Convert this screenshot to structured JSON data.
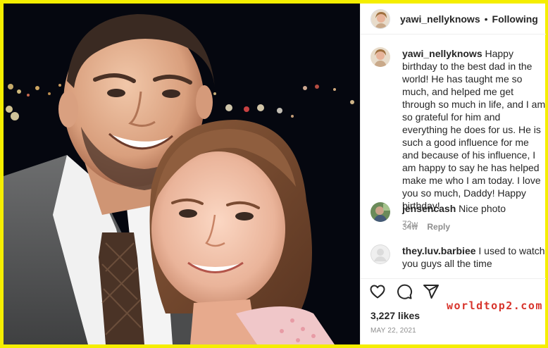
{
  "post": {
    "username": "yawi_nellyknows",
    "separator": "•",
    "follow_status": "Following",
    "caption_username": "yawi_nellyknows",
    "caption_text": "Happy birthday to the best dad in the world! He has taught me so much, and helped me get through so much in life, and I am so grateful for him and everything he does for us. He is such a good influence for me and because of his influence, I am happy to say he has helped make me who I am today. I love you so much, Daddy! Happy birthday!",
    "caption_time": "72w",
    "likes": "3,227 likes",
    "date": "MAY 22, 2021"
  },
  "comments": [
    {
      "username": "jensencash",
      "text": "Nice photo",
      "time": "34w",
      "reply_label": "Reply"
    },
    {
      "username": "they.luv.barbiee",
      "text": "I used to watch you guys all the time"
    }
  ],
  "icons": [
    "heart-icon",
    "comment-icon",
    "share-icon"
  ],
  "watermark": "worldtop2.com",
  "colors": {
    "frame": "#f5ee00",
    "text": "#262626",
    "muted": "#8e8e8e",
    "watermark": "#d8342c"
  }
}
